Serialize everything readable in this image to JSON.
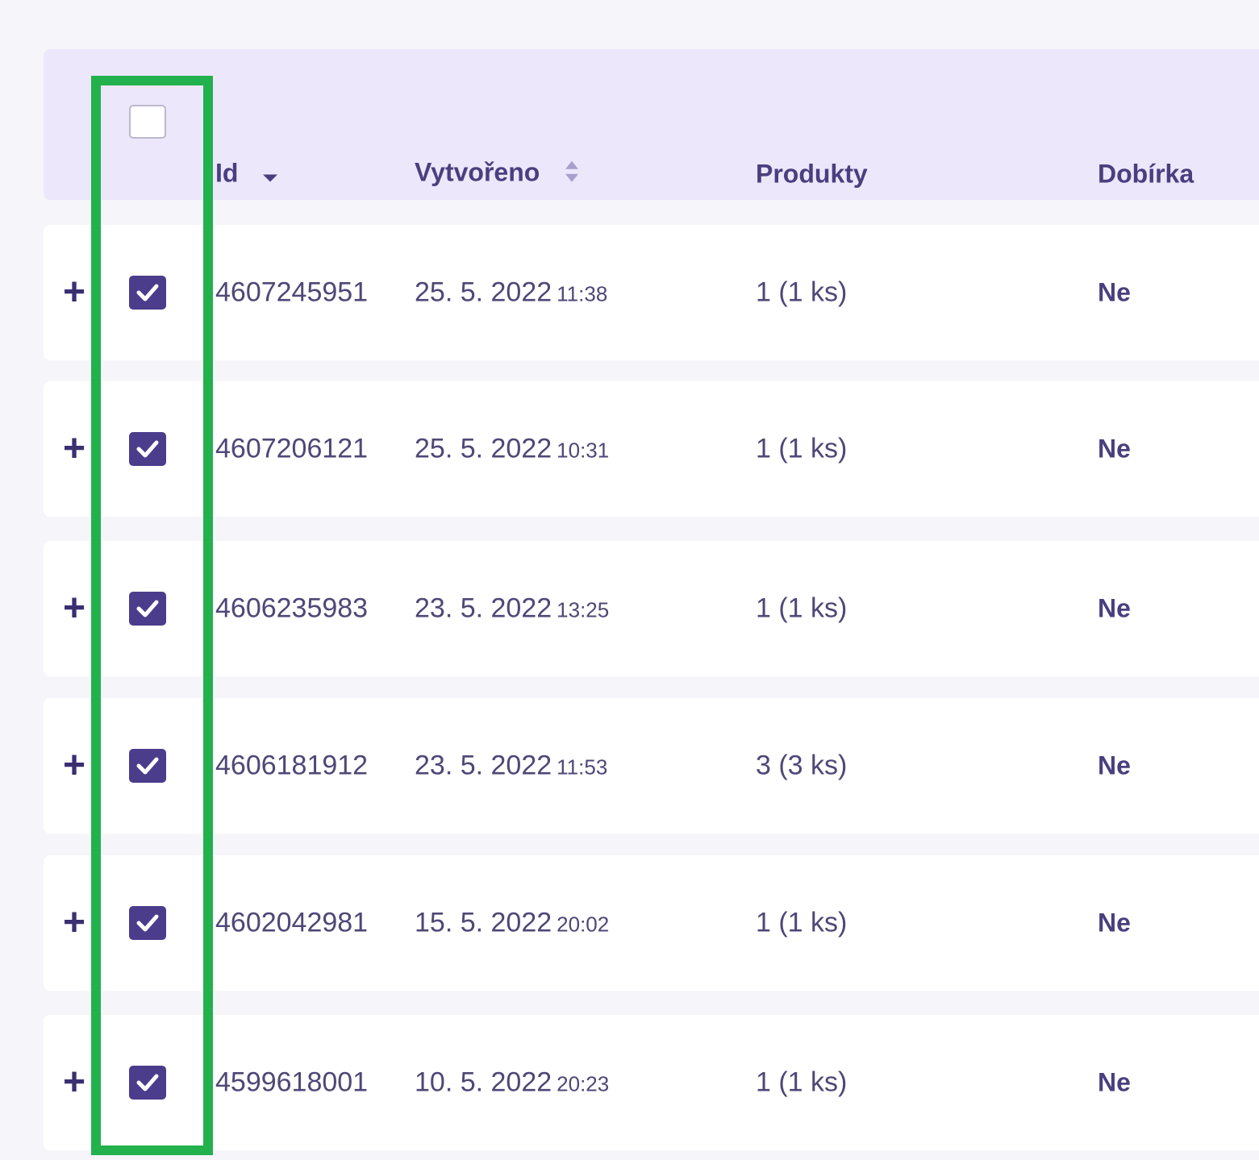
{
  "table": {
    "columns": {
      "id": "Id",
      "created": "Vytvořeno",
      "products": "Produkty",
      "cod": "Dobírka"
    },
    "header_checkbox_checked": false,
    "rows": [
      {
        "expand": "+",
        "checked": true,
        "id": "4607245951",
        "date": "25. 5. 2022",
        "time": "11:38",
        "products": "1 (1 ks)",
        "cod": "Ne"
      },
      {
        "expand": "+",
        "checked": true,
        "id": "4607206121",
        "date": "25. 5. 2022",
        "time": "10:31",
        "products": "1 (1 ks)",
        "cod": "Ne"
      },
      {
        "expand": "+",
        "checked": true,
        "id": "4606235983",
        "date": "23. 5. 2022",
        "time": "13:25",
        "products": "1 (1 ks)",
        "cod": "Ne"
      },
      {
        "expand": "+",
        "checked": true,
        "id": "4606181912",
        "date": "23. 5. 2022",
        "time": "11:53",
        "products": "3 (3 ks)",
        "cod": "Ne"
      },
      {
        "expand": "+",
        "checked": true,
        "id": "4602042981",
        "date": "15. 5. 2022",
        "time": "20:02",
        "products": "1 (1 ks)",
        "cod": "Ne"
      },
      {
        "expand": "+",
        "checked": true,
        "id": "4599618001",
        "date": "10. 5. 2022",
        "time": "20:23",
        "products": "1 (1 ks)",
        "cod": "Ne"
      }
    ]
  },
  "icons": {
    "expand": "plus-icon",
    "checkbox_check": "check-icon",
    "sort_id": "caret-down-icon",
    "sort_created": "sort-updown-icon"
  },
  "colors": {
    "header_bg": "#ece7fb",
    "accent": "#4b3c8c",
    "highlight": "#22b14c",
    "page_bg": "#f6f6fa"
  }
}
